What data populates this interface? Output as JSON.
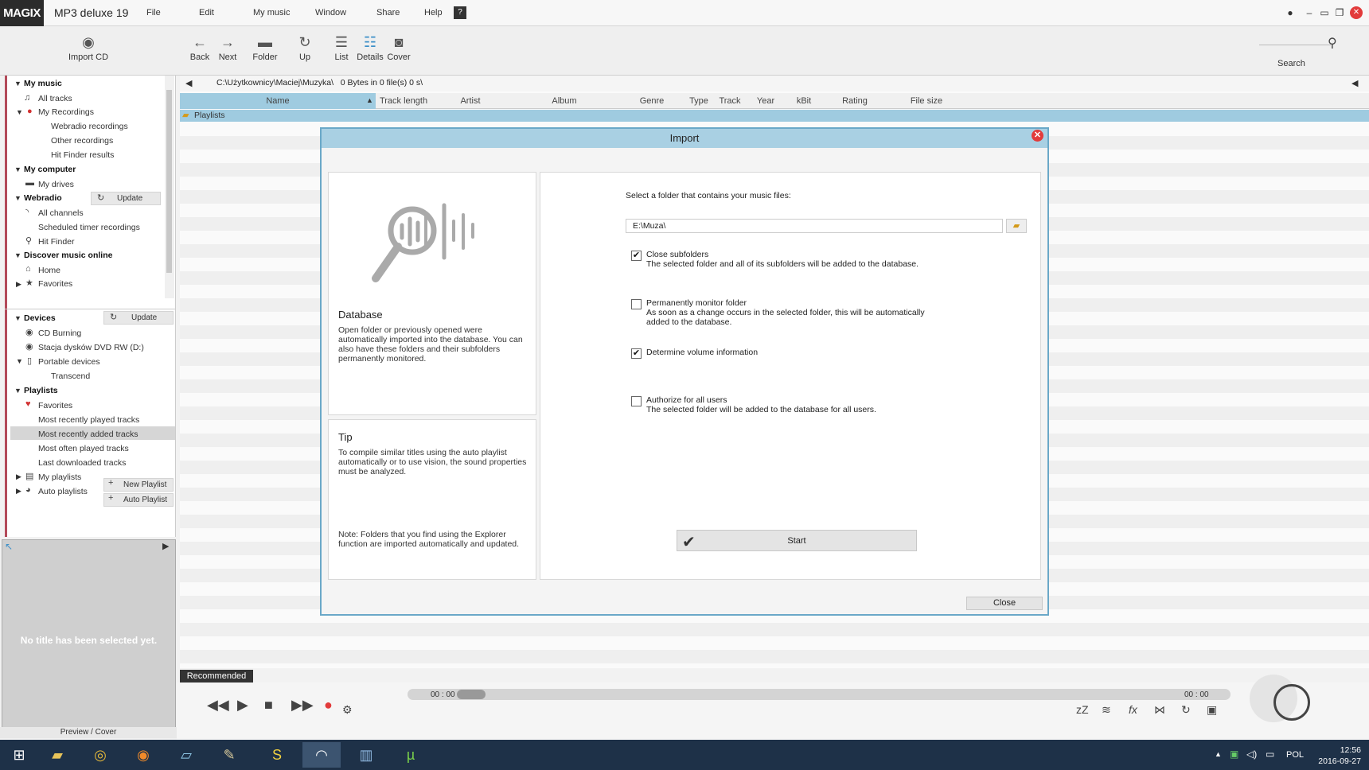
{
  "app": {
    "logo": "MAGIX",
    "title": "MP3 deluxe 19"
  },
  "menu": [
    "File",
    "Edit",
    "My music",
    "Window",
    "Share",
    "Help"
  ],
  "toolbar": {
    "import_cd": "Import CD",
    "back": "Back",
    "next": "Next",
    "folder": "Folder",
    "up": "Up",
    "list": "List",
    "details": "Details",
    "cover": "Cover",
    "search": "Search"
  },
  "sidebar": {
    "my_music": "My music",
    "all_tracks": "All tracks",
    "my_recordings": "My Recordings",
    "webradio_recordings": "Webradio recordings",
    "other_recordings": "Other recordings",
    "hit_finder_results": "Hit Finder results",
    "my_computer": "My computer",
    "my_drives": "My drives",
    "webradio": "Webradio",
    "update": "Update",
    "all_channels": "All channels",
    "scheduled": "Scheduled timer recordings",
    "hit_finder": "Hit Finder",
    "discover": "Discover music online",
    "home": "Home",
    "favorites": "Favorites",
    "devices": "Devices",
    "cd_burning": "CD Burning",
    "dvd": "Stacja dysków DVD RW (D:)",
    "portable": "Portable devices",
    "transcend": "Transcend",
    "playlists": "Playlists",
    "pl_favorites": "Favorites",
    "most_recent_played": "Most recently played tracks",
    "most_recent_added": "Most recently added tracks",
    "most_often": "Most often played tracks",
    "last_downloaded": "Last downloaded tracks",
    "my_playlists": "My playlists",
    "new_playlist": "New Playlist",
    "auto_playlists": "Auto playlists",
    "auto_playlist": "Auto Playlist"
  },
  "preview": {
    "empty": "No title has been selected yet.",
    "label": "Preview / Cover"
  },
  "browser": {
    "path": "C:\\Użytkownicy\\Maciej\\Muzyka\\",
    "info": "0 Bytes in 0 file(s) 0 s\\",
    "columns": [
      "Name",
      "Track length",
      "Artist",
      "Album",
      "Genre",
      "Type",
      "Track",
      "Year",
      "kBit",
      "Rating",
      "File size"
    ],
    "row_playlists": "Playlists"
  },
  "dialog": {
    "title": "Import",
    "db_heading": "Database",
    "db_text": "Open folder or previously opened were automatically imported into the database. You can also have these folders and their subfolders permanently monitored.",
    "tip_heading": "Tip",
    "tip_text": "To compile similar titles using the auto playlist automatically or to use vision, the sound properties must be analyzed.",
    "note_text": "Note: Folders that you find using the Explorer function are imported automatically and updated.",
    "select_label": "Select a folder that contains your music files:",
    "folder_value": "E:\\Muza\\",
    "opt1_title": "Close subfolders",
    "opt1_desc": "The selected folder and all of its subfolders will be added to the database.",
    "opt2_title": "Permanently monitor folder",
    "opt2_desc": "As soon as a change occurs in the selected folder, this will be automatically added to the database.",
    "opt3_title": "Determine volume information",
    "opt4_title": "Authorize for all users",
    "opt4_desc": "The selected folder will be added to the database for all users.",
    "start": "Start",
    "close": "Close"
  },
  "player": {
    "recommended": "Recommended",
    "time_start": "00 : 00",
    "time_end": "00 : 00"
  },
  "taskbar": {
    "lang": "POL",
    "time": "12:56",
    "date": "2016-09-27"
  }
}
